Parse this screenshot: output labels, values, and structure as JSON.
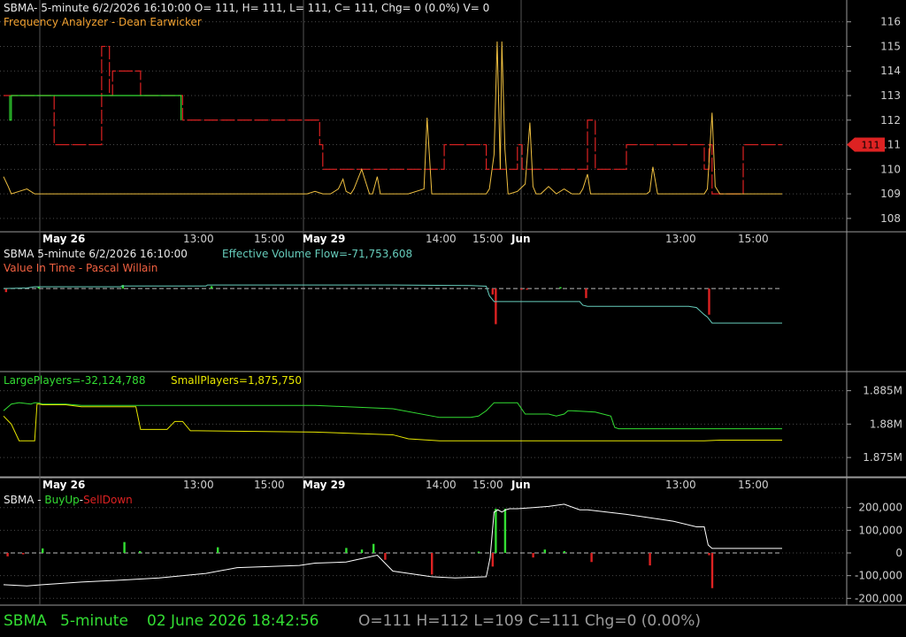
{
  "colors": {
    "background": "#000000",
    "grid": "#4a4a4a",
    "red": "#dd2222",
    "green": "#33dd33",
    "gold": "#f0c040",
    "cyan": "#66ccbb",
    "yellow": "#e6e600",
    "white": "#ffffff"
  },
  "panels": {
    "price": {
      "header": "SBMA- 5-minute 6/2/2026 16:10:00 O= 111, H= 111, L= 111, C= 111, Chg= 0 (0.0%) V= 0",
      "indicator": "Frequency Analyzer - Dean Earwicker",
      "last_marker": "111"
    },
    "volume": {
      "header": "SBMA 5-minute  6/2/2026 16:10:00",
      "flow_label": "Effective Volume Flow=-71,753,608",
      "indicator": "Value In Time - Pascal Willain"
    },
    "players": {
      "large_label": "LargePlayers=-32,124,788",
      "small_label": "SmallPlayers=1,875,750"
    },
    "buyup": {
      "prefix": "SBMA - ",
      "buy_label": "BuyUp",
      "dash": "-",
      "sell_label": "SellDown"
    }
  },
  "status_bar": {
    "symbol": "SBMA",
    "interval": "5-minute",
    "datetime": "02 June 2026 18:42:56",
    "ohlc": "O=111  H=112  L=109  C=111  Chg=0 (0.00%)"
  },
  "chart_data": [
    {
      "type": "line",
      "name": "price-frequency",
      "x_tick_labels": [
        "May 26",
        "13:00",
        "15:00",
        "May 29",
        "14:00",
        "15:00",
        "Jun",
        "13:00",
        "15:00"
      ],
      "y_ticks": [
        108,
        109,
        110,
        111,
        112,
        113,
        114,
        115,
        116
      ],
      "ylim": [
        107.6,
        116.6
      ],
      "xlim": [
        0,
        100
      ],
      "grid": true,
      "series": [
        {
          "role": "close",
          "color": "gold",
          "x": [
            0,
            0.6,
            1,
            2,
            3,
            4,
            5,
            6,
            8,
            15,
            20,
            30,
            39,
            40,
            41,
            42,
            43,
            43.6,
            44,
            44.6,
            45,
            46,
            47,
            47.4,
            48,
            48.4,
            49,
            50,
            52,
            54,
            54.4,
            55,
            55.4,
            56,
            58,
            60,
            62,
            62.4,
            63,
            63.4,
            63.8,
            64,
            64.4,
            64.8,
            65,
            66,
            67,
            67.6,
            68,
            68.4,
            69,
            70,
            71,
            72,
            73,
            74,
            74.4,
            75,
            75.4,
            76,
            80,
            82,
            82.6,
            83,
            83.4,
            84,
            88,
            90,
            90.4,
            91,
            91.4,
            92,
            100
          ],
          "y": [
            109.7,
            109.3,
            109.0,
            109.1,
            109.2,
            109.0,
            109.0,
            109.0,
            109.0,
            109.0,
            109.0,
            109.0,
            109.0,
            109.1,
            109.0,
            109.0,
            109.2,
            109.6,
            109.1,
            109.0,
            109.2,
            110.0,
            109.0,
            109.0,
            109.7,
            109.0,
            109.0,
            109.0,
            109.0,
            109.2,
            112.1,
            109.0,
            109.0,
            109.0,
            109.0,
            109.0,
            109.0,
            109.2,
            110.6,
            115.2,
            110.0,
            115.2,
            110.8,
            109.0,
            109.0,
            109.1,
            109.4,
            111.9,
            109.3,
            109.0,
            109.0,
            109.3,
            109.0,
            109.2,
            109.0,
            109.0,
            109.2,
            109.8,
            109.0,
            109.0,
            109.0,
            109.0,
            109.0,
            109.1,
            110.1,
            109.0,
            109.0,
            109.0,
            109.2,
            112.3,
            109.3,
            109.0,
            109.0
          ]
        },
        {
          "role": "frequency-red",
          "color": "red",
          "x": [
            0,
            6,
            6.5,
            7,
            12,
            12.6,
            13,
            13.6,
            14,
            17,
            17.6,
            18,
            22,
            23,
            26,
            39,
            40,
            40.6,
            41,
            56,
            56.6,
            57,
            62,
            64,
            66,
            66.6,
            74,
            75,
            76,
            79,
            80,
            90,
            90.6,
            91,
            91.6,
            95,
            100
          ],
          "y": [
            113,
            113,
            111,
            111,
            111,
            115,
            115,
            113,
            114,
            114,
            113,
            113,
            113,
            112,
            112,
            112,
            112,
            111,
            110,
            110,
            111,
            111,
            110,
            110,
            111,
            110,
            110,
            112,
            110,
            110,
            111,
            110,
            111,
            109,
            109,
            111,
            111
          ]
        },
        {
          "role": "frequency-green",
          "color": "green",
          "x": [
            0.8,
            0.8,
            1,
            1,
            22.8,
            22.8
          ],
          "y": [
            113,
            112,
            112,
            113,
            113,
            112
          ]
        }
      ]
    },
    {
      "type": "bar",
      "name": "value-in-time",
      "ylim": [
        -55,
        15
      ],
      "zero_line": 0,
      "flow_series": {
        "color": "cyan",
        "x": [
          0,
          3,
          4,
          15,
          15.2,
          26,
          26.2,
          30,
          40,
          50,
          60,
          62,
          62.4,
          63,
          65,
          73,
          74,
          74.4,
          75,
          88,
          89,
          90,
          90.4,
          91,
          100
        ],
        "y": [
          0,
          0.5,
          1.5,
          1.5,
          2.2,
          2.2,
          3,
          3,
          3,
          3,
          2.5,
          2,
          -6,
          -11,
          -11,
          -11,
          -11,
          -14,
          -15,
          -15,
          -16,
          -22,
          -24,
          -29,
          -29
        ]
      },
      "bars": [
        {
          "x": 0.3,
          "v": -3
        },
        {
          "x": 4.5,
          "v": 1.5
        },
        {
          "x": 15.3,
          "v": 3
        },
        {
          "x": 26.7,
          "v": 2
        },
        {
          "x": 62.8,
          "v": -5
        },
        {
          "x": 63.2,
          "v": -30
        },
        {
          "x": 66.5,
          "v": -1
        },
        {
          "x": 71.5,
          "v": 1.2
        },
        {
          "x": 74.8,
          "v": -8
        },
        {
          "x": 90.6,
          "v": -22
        },
        {
          "x": 67.2,
          "v": -1
        }
      ]
    },
    {
      "type": "line",
      "name": "players",
      "y_ticks": [
        1.875,
        1.88,
        1.885
      ],
      "y_tick_labels": [
        "1.875M",
        "1.88M",
        "1.885M"
      ],
      "ylim": [
        1.8725,
        1.8868
      ],
      "series": [
        {
          "role": "large",
          "color": "green",
          "x": [
            0,
            1,
            2,
            3.5,
            4,
            4.4,
            5,
            8,
            10,
            40,
            50,
            56,
            60,
            61,
            62,
            63,
            63.5,
            66,
            67,
            70,
            71,
            72,
            72.5,
            73,
            76,
            78,
            78.5,
            79,
            80,
            82,
            100
          ],
          "y": [
            1.882,
            1.883,
            1.8832,
            1.883,
            1.8832,
            1.8832,
            1.883,
            1.883,
            1.8828,
            1.8828,
            1.8823,
            1.881,
            1.881,
            1.8812,
            1.882,
            1.8832,
            1.8832,
            1.8832,
            1.8815,
            1.8815,
            1.8812,
            1.8815,
            1.882,
            1.882,
            1.8818,
            1.8812,
            1.8795,
            1.8793,
            1.8793,
            1.8793,
            1.8793
          ]
        },
        {
          "role": "small",
          "color": "yellow",
          "x": [
            0,
            1,
            2,
            3,
            4,
            4.3,
            4.6,
            5,
            8,
            10,
            17,
            17.6,
            18,
            21,
            22,
            23,
            24,
            25,
            40,
            50,
            52,
            56,
            60,
            62,
            66,
            70,
            80,
            90,
            92,
            100
          ],
          "y": [
            1.8812,
            1.88,
            1.8775,
            1.8775,
            1.8775,
            1.883,
            1.883,
            1.8829,
            1.8829,
            1.8826,
            1.8826,
            1.8792,
            1.8792,
            1.8792,
            1.8804,
            1.8804,
            1.879,
            1.879,
            1.8788,
            1.8784,
            1.8778,
            1.8775,
            1.8775,
            1.8775,
            1.8775,
            1.8775,
            1.8775,
            1.8775,
            1.8776,
            1.8776
          ]
        }
      ]
    },
    {
      "type": "bar",
      "name": "buyup-selldown",
      "y_ticks": [
        -200000,
        -100000,
        0,
        100000,
        200000
      ],
      "y_tick_labels": [
        "-200,000",
        "-100,000",
        "0",
        "100,000",
        "200,000"
      ],
      "ylim": [
        -230000,
        230000
      ],
      "white_line": {
        "color": "white",
        "x": [
          0,
          3,
          5,
          10,
          15,
          20,
          26,
          30,
          38,
          40,
          44,
          46,
          48,
          50,
          54,
          55,
          58,
          62,
          62.5,
          63,
          63.5,
          64,
          64.5,
          65,
          66,
          68,
          70,
          72,
          74,
          75,
          80,
          84,
          86,
          89,
          90,
          90.5,
          91,
          92,
          100
        ],
        "y": [
          -140000,
          -145000,
          -140000,
          -128000,
          -120000,
          -110000,
          -90000,
          -65000,
          -55000,
          -45000,
          -40000,
          -25000,
          -10000,
          -80000,
          -100000,
          -105000,
          -110000,
          -105000,
          -20000,
          180000,
          190000,
          180000,
          190000,
          195000,
          195000,
          200000,
          205000,
          215000,
          190000,
          190000,
          170000,
          150000,
          140000,
          115000,
          115000,
          35000,
          20000,
          20000,
          20000
        ]
      },
      "bars": [
        {
          "x": 0.5,
          "v": -15000
        },
        {
          "x": 2.5,
          "v": -6000
        },
        {
          "x": 5,
          "v": 20000
        },
        {
          "x": 15.5,
          "v": 48000
        },
        {
          "x": 17.5,
          "v": 8000
        },
        {
          "x": 27.5,
          "v": 25000
        },
        {
          "x": 44,
          "v": 22000
        },
        {
          "x": 46,
          "v": 15000
        },
        {
          "x": 47.5,
          "v": 40000
        },
        {
          "x": 49,
          "v": -30000
        },
        {
          "x": 55,
          "v": -95000
        },
        {
          "x": 63.2,
          "v": 195000
        },
        {
          "x": 64.4,
          "v": 195000
        },
        {
          "x": 62.8,
          "v": -60000
        },
        {
          "x": 68,
          "v": -20000
        },
        {
          "x": 69.5,
          "v": 15000
        },
        {
          "x": 72,
          "v": 8000
        },
        {
          "x": 75.5,
          "v": -40000
        },
        {
          "x": 83,
          "v": -55000
        },
        {
          "x": 91,
          "v": -155000
        },
        {
          "x": 90.6,
          "v": -10000
        },
        {
          "x": 61,
          "v": 6000
        }
      ]
    }
  ]
}
